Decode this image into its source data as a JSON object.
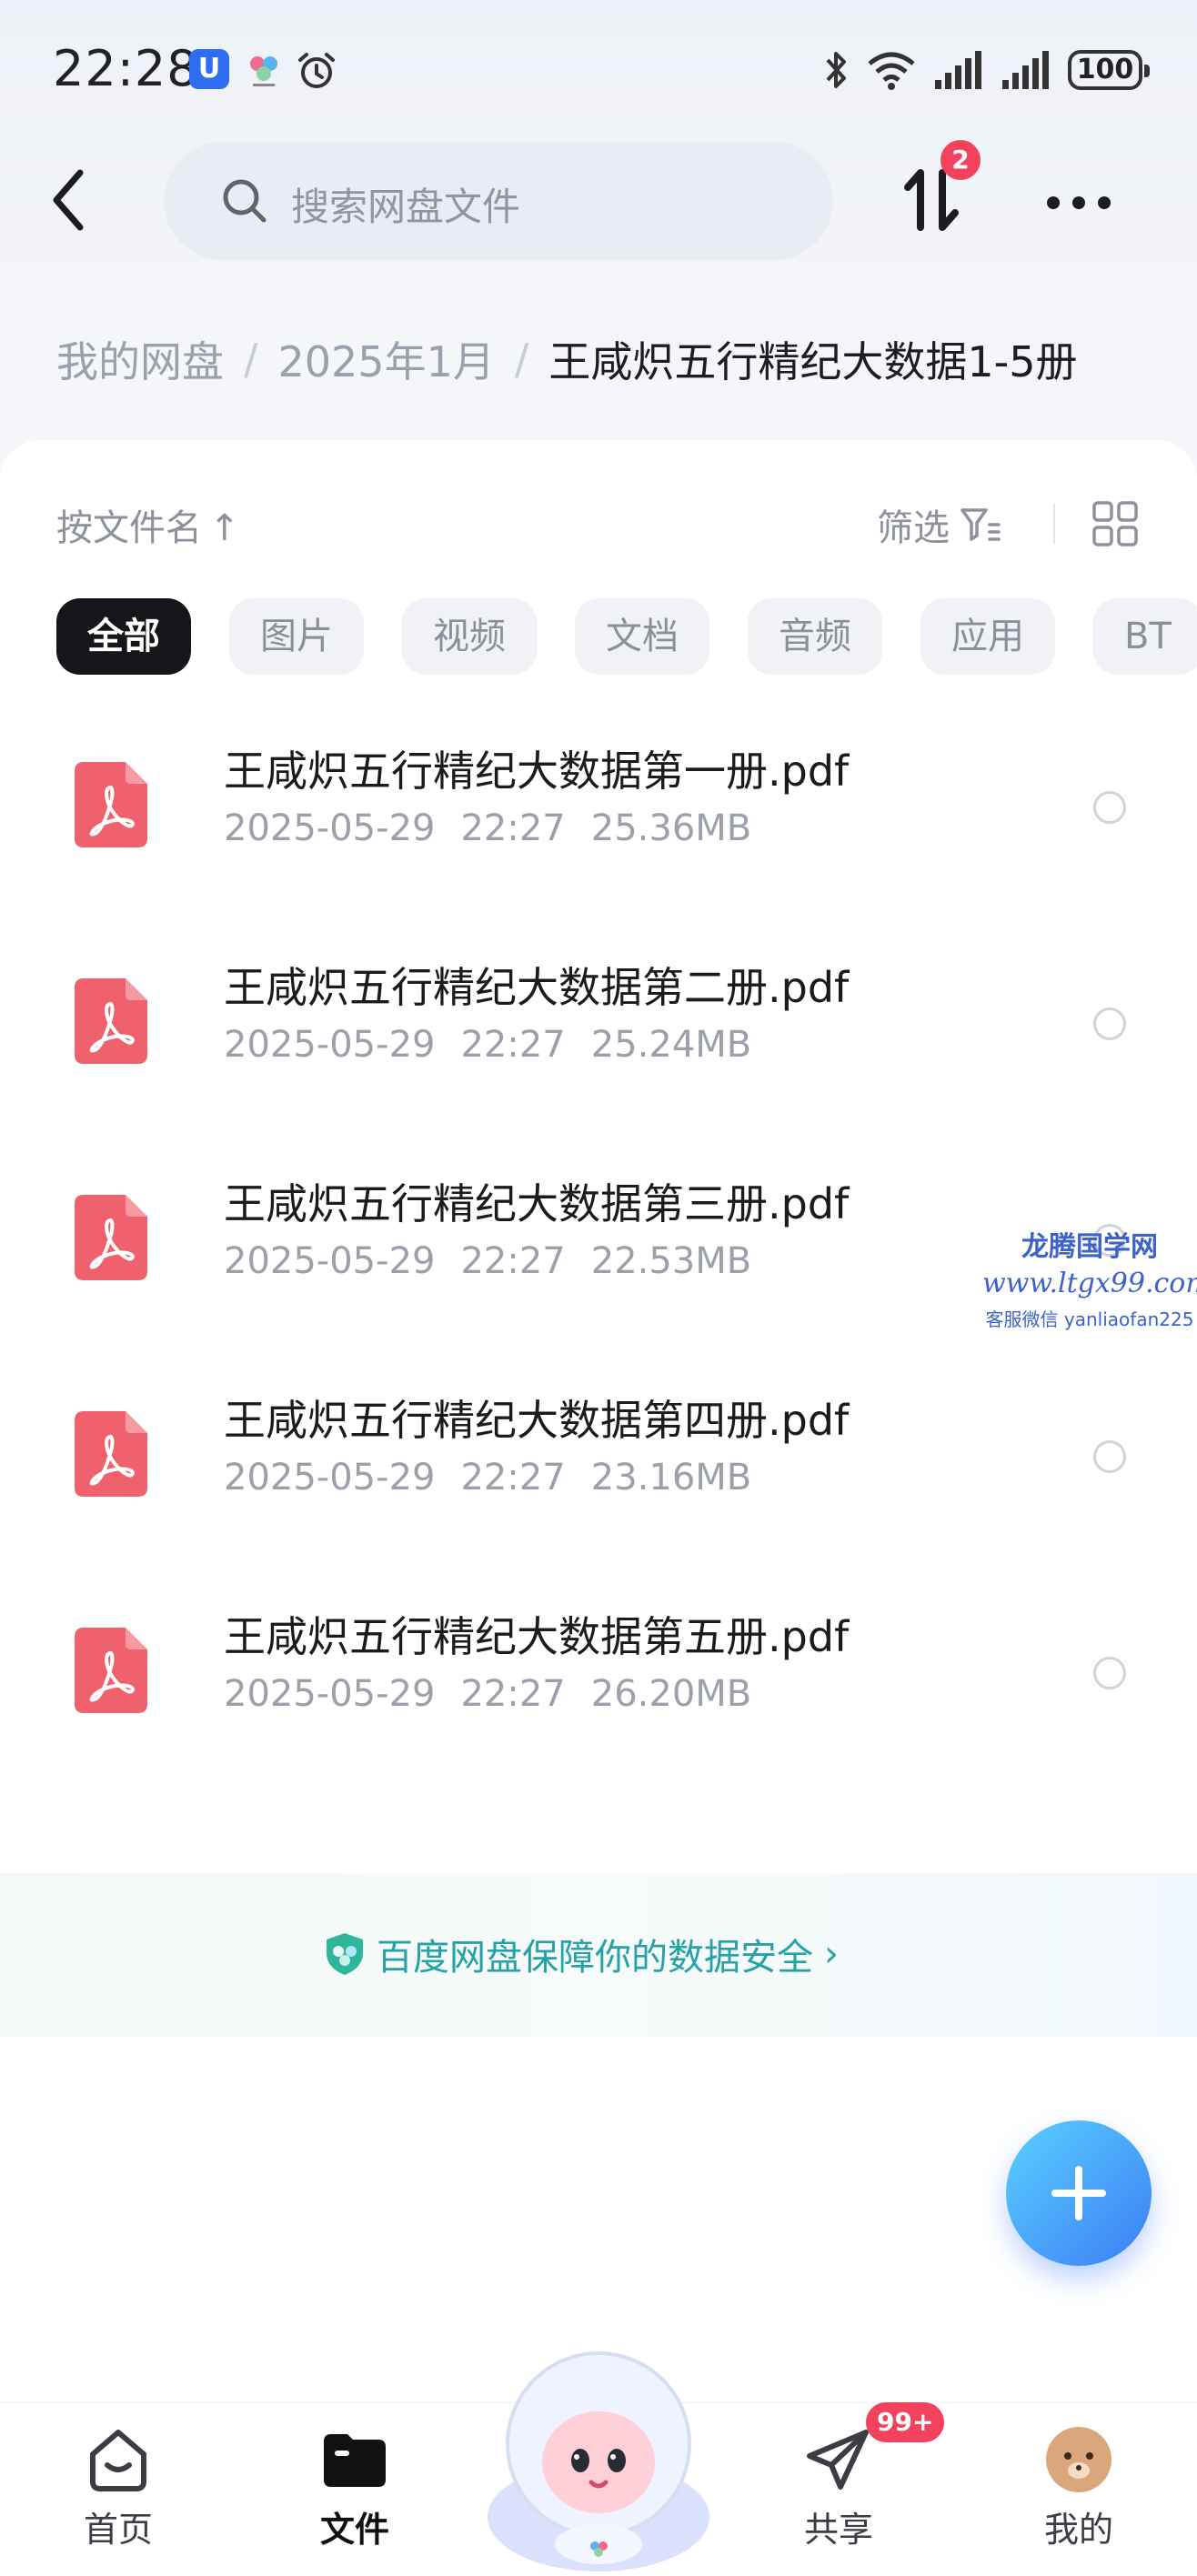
{
  "status_bar": {
    "time": "22:28",
    "battery": "100"
  },
  "header": {
    "search_placeholder": "搜索网盘文件",
    "transfer_badge": "2"
  },
  "breadcrumb": {
    "items": [
      "我的网盘",
      "2025年1月"
    ],
    "current": "王咸炽五行精纪大数据1-5册"
  },
  "toolbar": {
    "sort_label": "按文件名",
    "sort_arrow": "↑",
    "filter_label": "筛选"
  },
  "chips": [
    "全部",
    "图片",
    "视频",
    "文档",
    "音频",
    "应用",
    "BT"
  ],
  "files": [
    {
      "name": "王咸炽五行精纪大数据第一册.pdf",
      "date": "2025-05-29",
      "time": "22:27",
      "size": "25.36MB"
    },
    {
      "name": "王咸炽五行精纪大数据第二册.pdf",
      "date": "2025-05-29",
      "time": "22:27",
      "size": "25.24MB"
    },
    {
      "name": "王咸炽五行精纪大数据第三册.pdf",
      "date": "2025-05-29",
      "time": "22:27",
      "size": "22.53MB"
    },
    {
      "name": "王咸炽五行精纪大数据第四册.pdf",
      "date": "2025-05-29",
      "time": "22:27",
      "size": "23.16MB"
    },
    {
      "name": "王咸炽五行精纪大数据第五册.pdf",
      "date": "2025-05-29",
      "time": "22:27",
      "size": "26.20MB"
    }
  ],
  "watermark": {
    "line1": "龙腾国学网",
    "line2": "www.ltgx99.com",
    "line3": "客服微信 yanliaofan225"
  },
  "security_banner": {
    "text": "百度网盘保障你的数据安全",
    "chevron": "›"
  },
  "bottom_nav": {
    "tabs": [
      {
        "label": "首页",
        "icon": "home-icon"
      },
      {
        "label": "文件",
        "icon": "folder-icon"
      },
      {
        "label": "共享",
        "icon": "send-icon"
      },
      {
        "label": "我的",
        "icon": "avatar-icon"
      }
    ],
    "share_badge": "99+"
  },
  "colors": {
    "accent_blue": "#3b7ef5",
    "badge_red": "#f2425d",
    "pdf_red": "#f0616e",
    "banner_teal": "#24a2a6"
  }
}
